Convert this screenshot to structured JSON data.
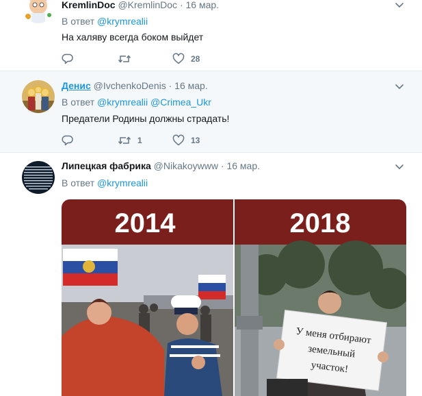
{
  "tweets": [
    {
      "name": "KremlinDoc",
      "handle": "@KremlinDoc",
      "dot": "·",
      "date": "16 мар.",
      "reply_prefix": "В ответ",
      "mentions": [
        "@krymrealii"
      ],
      "text": "На халяву всегда боком выйдет",
      "replies": "",
      "retweets": "",
      "likes": "28"
    },
    {
      "name": "Денис",
      "handle": "@IvchenkoDenis",
      "dot": "·",
      "date": "16 мар.",
      "reply_prefix": "В ответ",
      "mentions": [
        "@krymrealii",
        "@Crimea_Ukr"
      ],
      "text": "Предатели Родины должны страдать!",
      "replies": "",
      "retweets": "1",
      "likes": "13"
    },
    {
      "name": "Липецкая фабрика",
      "handle": "@Nikakoywww",
      "dot": "·",
      "date": "16 мар.",
      "reply_prefix": "В ответ",
      "mentions": [
        "@krymrealii"
      ],
      "media": {
        "year_left": "2014",
        "year_right": "2018",
        "sign_text": [
          "У меня отбирают",
          "земельный",
          "участок!"
        ]
      }
    }
  ],
  "colors": {
    "link": "#1b95e0",
    "muted": "#657786",
    "banner": "#7a1f1c",
    "highlight_bg": "#f5f8fa"
  },
  "icons": [
    "avatar-cartoon-doctor",
    "avatar-saints",
    "avatar-text-collage",
    "chevron-down-icon",
    "reply-icon",
    "retweet-icon",
    "heart-icon"
  ]
}
